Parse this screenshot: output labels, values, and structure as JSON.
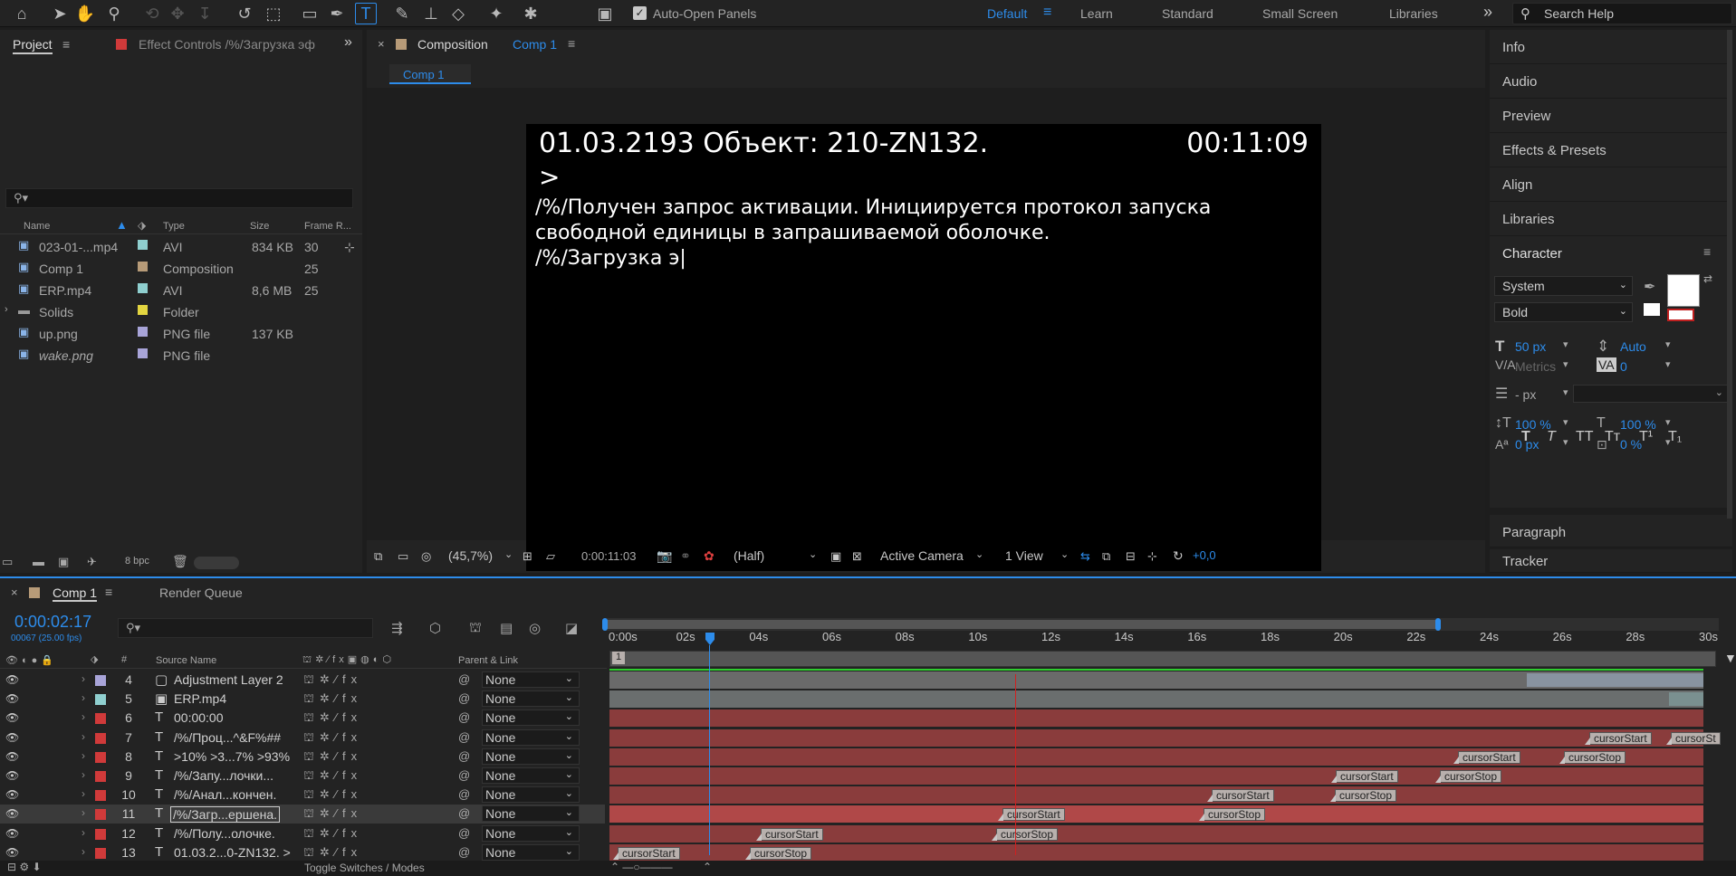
{
  "toolbar": {
    "auto_open_label": "Auto-Open Panels",
    "workspaces": [
      "Default",
      "Learn",
      "Standard",
      "Small Screen",
      "Libraries"
    ],
    "search_placeholder": "Search Help"
  },
  "project": {
    "tab_project": "Project",
    "tab_effect": "Effect Controls /%/Загрузка эф",
    "columns": [
      "Name",
      "Type",
      "Size",
      "Frame R..."
    ],
    "items": [
      {
        "name": "023-01-...mp4",
        "type": "AVI",
        "size": "834 KB",
        "frame": "30",
        "color": "#8fcfcf"
      },
      {
        "name": "Comp 1",
        "type": "Composition",
        "size": "",
        "frame": "25",
        "color": "#b79b78"
      },
      {
        "name": "ERP.mp4",
        "type": "AVI",
        "size": "8,6 MB",
        "frame": "25",
        "color": "#8fcfcf"
      },
      {
        "name": "Solids",
        "type": "Folder",
        "size": "",
        "frame": "",
        "color": "#e3d540"
      },
      {
        "name": "up.png",
        "type": "PNG file",
        "size": "137 KB",
        "frame": "",
        "color": "#a8a4d8"
      },
      {
        "name": "wake.png",
        "type": "PNG file",
        "size": "",
        "frame": "",
        "color": "#a8a4d8"
      }
    ],
    "bpc": "8 bpc"
  },
  "composition": {
    "tab_prefix": "Composition",
    "tab_name": "Comp 1",
    "chip": "Comp 1",
    "line1": "01.03.2193 Объект: 210-ZN132.",
    "clock": "00:11:09",
    "prompt": ">",
    "line2": "/%/Получен запрос активации. Инициируется протокол запуска",
    "line3": "свободной единицы в запрашиваемой оболочке.",
    "line4": "/%/Загрузка э|",
    "zoom": "(45,7%)",
    "timecode": "0:00:11:03",
    "resolution": "(Half)",
    "camera": "Active Camera",
    "views": "1 View",
    "exposure": "+0,0"
  },
  "right_panels": {
    "items": [
      "Info",
      "Audio",
      "Preview",
      "Effects & Presets",
      "Align",
      "Libraries"
    ],
    "character": {
      "title": "Character",
      "font": "System",
      "style": "Bold",
      "size": "50 px",
      "leading": "Auto",
      "kerning": "Metrics",
      "tracking": "0",
      "stroke": "- px",
      "vscale": "100 %",
      "hscale": "100 %",
      "baseline": "0 px",
      "tsume": "0 %",
      "styles": [
        "T",
        "T",
        "TT",
        "Tт",
        "T¹",
        "T₁"
      ]
    },
    "paragraph": "Paragraph",
    "tracker": "Tracker"
  },
  "timeline": {
    "tab_comp": "Comp 1",
    "tab_render": "Render Queue",
    "timecode": "0:00:02:17",
    "frames": "00067 (25.00 fps)",
    "col_source": "Source Name",
    "col_parent": "Parent & Link",
    "ruler": [
      "0:00s",
      "02s",
      "04s",
      "06s",
      "08s",
      "10s",
      "12s",
      "14s",
      "16s",
      "18s",
      "20s",
      "22s",
      "24s",
      "26s",
      "28s",
      "30s"
    ],
    "layers": [
      {
        "num": "4",
        "name": "Adjustment Layer 2",
        "color": "#a8a4d8",
        "type": "adj",
        "parent": "None"
      },
      {
        "num": "5",
        "name": "ERP.mp4",
        "color": "#8fcfcf",
        "type": "video",
        "parent": "None"
      },
      {
        "num": "6",
        "name": "00:00:00",
        "color": "#d03a3a",
        "type": "T",
        "parent": "None"
      },
      {
        "num": "7",
        "name": "/%/Проц...^&F%##",
        "color": "#d03a3a",
        "type": "T",
        "parent": "None"
      },
      {
        "num": "8",
        "name": ">10% >3...7% >93%",
        "color": "#d03a3a",
        "type": "T",
        "parent": "None"
      },
      {
        "num": "9",
        "name": "/%/Запу...лочки...",
        "color": "#d03a3a",
        "type": "T",
        "parent": "None"
      },
      {
        "num": "10",
        "name": "/%/Анал...кончен.",
        "color": "#d03a3a",
        "type": "T",
        "parent": "None"
      },
      {
        "num": "11",
        "name": "/%/Загр...ершена.",
        "color": "#d03a3a",
        "type": "T",
        "parent": "None"
      },
      {
        "num": "12",
        "name": "/%/Полу...олочке.",
        "color": "#d03a3a",
        "type": "T",
        "parent": "None"
      },
      {
        "num": "13",
        "name": "01.03.2...0-ZN132. >",
        "color": "#d03a3a",
        "type": "T",
        "parent": "None"
      }
    ],
    "markers": [
      {
        "row": 3,
        "label": "cursorStart",
        "at": 1755
      },
      {
        "row": 3,
        "label": "cursorSt",
        "at": 1845
      },
      {
        "row": 4,
        "label": "cursorStart",
        "at": 1610
      },
      {
        "row": 4,
        "label": "cursorStop",
        "at": 1727
      },
      {
        "row": 5,
        "label": "cursorStart",
        "at": 1475
      },
      {
        "row": 5,
        "label": "cursorStop",
        "at": 1590
      },
      {
        "row": 6,
        "label": "cursorStart",
        "at": 1338
      },
      {
        "row": 6,
        "label": "cursorStop",
        "at": 1474
      },
      {
        "row": 7,
        "label": "cursorStart",
        "at": 1107
      },
      {
        "row": 7,
        "label": "cursorStop",
        "at": 1329
      },
      {
        "row": 8,
        "label": "cursorStart",
        "at": 840
      },
      {
        "row": 8,
        "label": "cursorStop",
        "at": 1100
      },
      {
        "row": 9,
        "label": "cursorStart",
        "at": 682
      },
      {
        "row": 9,
        "label": "cursorStop",
        "at": 828
      }
    ],
    "toggle_label": "Toggle Switches / Modes"
  }
}
